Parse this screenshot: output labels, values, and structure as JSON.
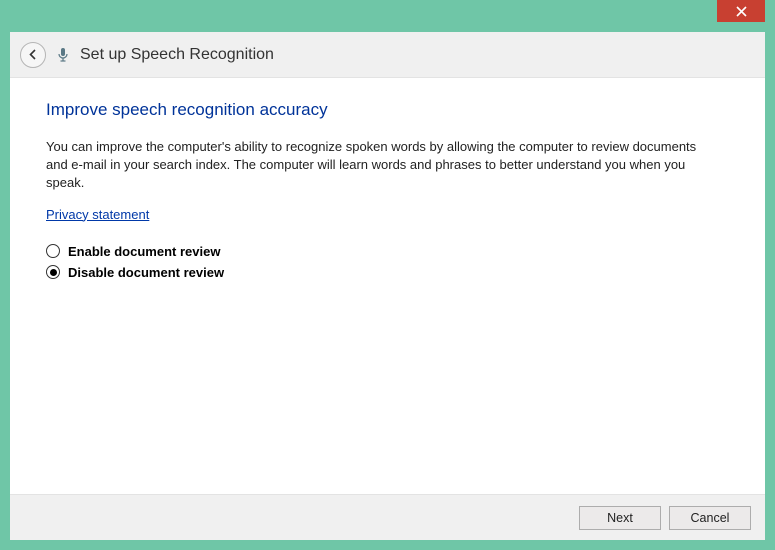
{
  "wizard": {
    "title": "Set up Speech Recognition"
  },
  "content": {
    "heading": "Improve speech recognition accuracy",
    "body": "You can improve the computer's ability to recognize spoken words by allowing the computer to review documents and e-mail in your search index. The computer will learn words and phrases to better understand you when you speak.",
    "privacy_link": "Privacy statement",
    "options": {
      "enable": "Enable document review",
      "disable": "Disable document review"
    },
    "selected": "disable"
  },
  "footer": {
    "next": "Next",
    "cancel": "Cancel"
  }
}
